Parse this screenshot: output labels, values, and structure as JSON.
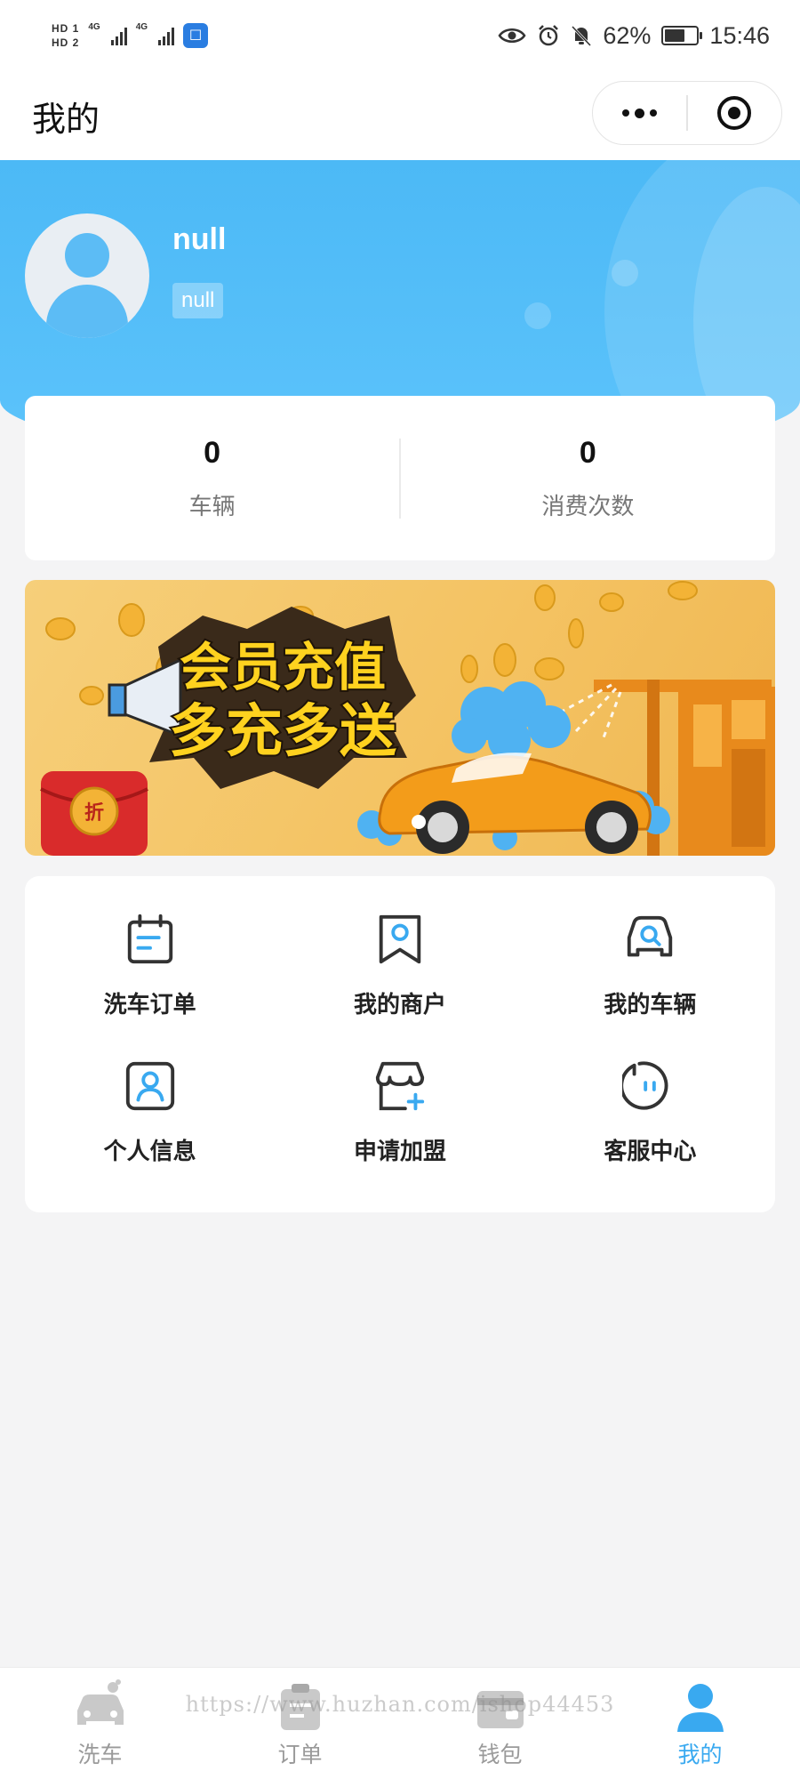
{
  "status_bar": {
    "sim1": "HD 1",
    "sim2": "HD 2",
    "net1": "4G",
    "net2": "4G",
    "battery_percent": "62%",
    "battery_level": 0.62,
    "time": "15:46",
    "icons": [
      "eye-icon",
      "alarm-icon",
      "bell-muted-icon",
      "battery-icon"
    ]
  },
  "nav": {
    "title": "我的"
  },
  "profile": {
    "name": "null",
    "tag": "null"
  },
  "stats": [
    {
      "value": "0",
      "label": "车辆"
    },
    {
      "value": "0",
      "label": "消费次数"
    }
  ],
  "banner": {
    "line1": "会员充值",
    "line2": "多充多送",
    "coupon": "折"
  },
  "menu": [
    {
      "label": "洗车订单",
      "icon": "calendar-list-icon"
    },
    {
      "label": "我的商户",
      "icon": "bookmark-location-icon"
    },
    {
      "label": "我的车辆",
      "icon": "car-search-icon"
    },
    {
      "label": "个人信息",
      "icon": "user-card-icon"
    },
    {
      "label": "申请加盟",
      "icon": "store-plus-icon"
    },
    {
      "label": "客服中心",
      "icon": "chat-face-icon"
    }
  ],
  "tabs": [
    {
      "label": "洗车",
      "icon": "car-wash-icon",
      "active": false
    },
    {
      "label": "订单",
      "icon": "clipboard-icon",
      "active": false
    },
    {
      "label": "钱包",
      "icon": "wallet-icon",
      "active": false
    },
    {
      "label": "我的",
      "icon": "user-icon",
      "active": true
    }
  ],
  "watermark": "https://www.huzhan.com/ishop44453",
  "colors": {
    "accent": "#39a9f0",
    "header": "#4cb9f6",
    "icon_dark": "#333333"
  }
}
